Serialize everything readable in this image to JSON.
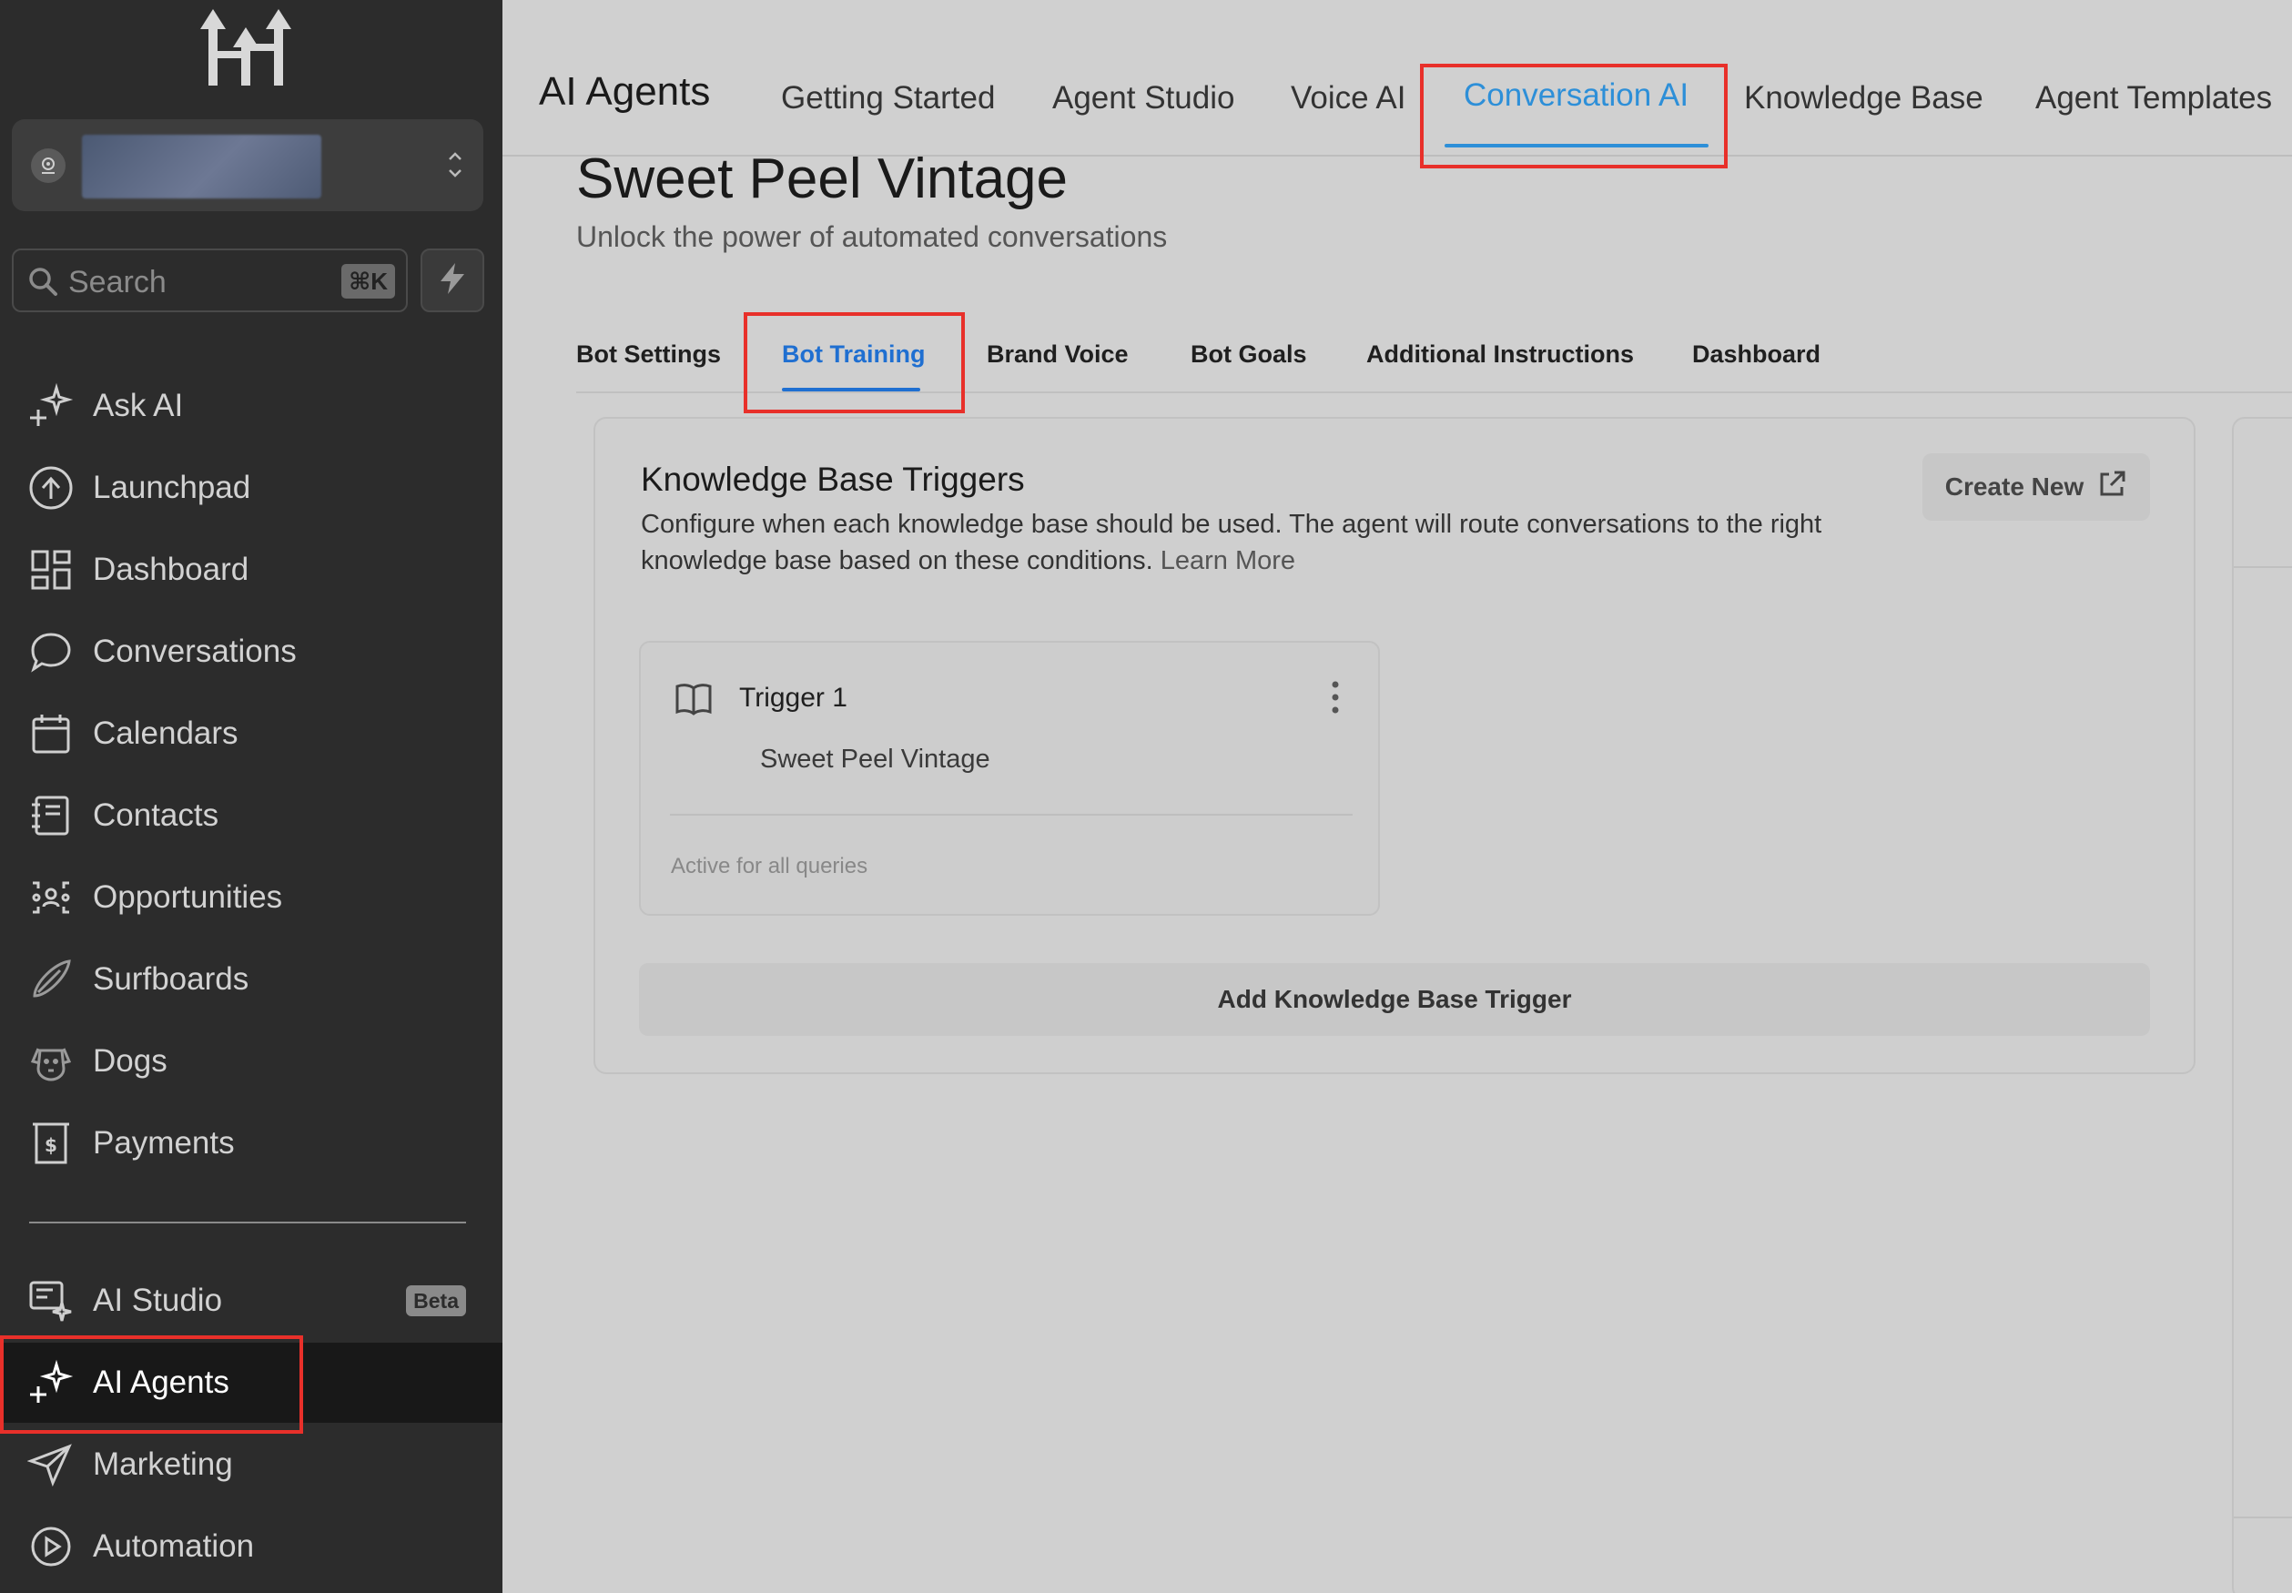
{
  "sidebar": {
    "search": {
      "placeholder": "Search",
      "shortcut": "⌘K"
    },
    "items": [
      {
        "label": "Ask AI",
        "icon": "sparkle-plus-icon"
      },
      {
        "label": "Launchpad",
        "icon": "launchpad-icon"
      },
      {
        "label": "Dashboard",
        "icon": "dashboard-grid-icon"
      },
      {
        "label": "Conversations",
        "icon": "chat-bubble-icon"
      },
      {
        "label": "Calendars",
        "icon": "calendar-icon"
      },
      {
        "label": "Contacts",
        "icon": "contacts-book-icon"
      },
      {
        "label": "Opportunities",
        "icon": "opportunities-icon"
      },
      {
        "label": "Surfboards",
        "icon": "surfboard-icon"
      },
      {
        "label": "Dogs",
        "icon": "dog-icon"
      },
      {
        "label": "Payments",
        "icon": "payments-receipt-icon"
      }
    ],
    "bottom_items": [
      {
        "label": "AI Studio",
        "icon": "ai-studio-icon",
        "badge": "Beta"
      },
      {
        "label": "AI Agents",
        "icon": "sparkle-plus-icon",
        "active": true
      },
      {
        "label": "Marketing",
        "icon": "send-icon"
      },
      {
        "label": "Automation",
        "icon": "automation-play-icon"
      }
    ]
  },
  "topnav": {
    "title": "AI Agents",
    "tabs": [
      {
        "label": "Getting Started"
      },
      {
        "label": "Agent Studio"
      },
      {
        "label": "Voice AI"
      },
      {
        "label": "Conversation AI",
        "active": true
      },
      {
        "label": "Knowledge Base"
      },
      {
        "label": "Agent Templates"
      }
    ]
  },
  "page": {
    "title": "Sweet Peel Vintage",
    "subtitle": "Unlock the power of automated conversations"
  },
  "subtabs": [
    {
      "label": "Bot Settings"
    },
    {
      "label": "Bot Training",
      "active": true
    },
    {
      "label": "Brand Voice"
    },
    {
      "label": "Bot Goals"
    },
    {
      "label": "Additional Instructions"
    },
    {
      "label": "Dashboard"
    }
  ],
  "kb_triggers": {
    "title": "Knowledge Base Triggers",
    "description": "Configure when each knowledge base should be used. The agent will route conversations to the right knowledge base based on these conditions.",
    "learn_more": "Learn More",
    "create_new": "Create New",
    "triggers": [
      {
        "name": "Trigger 1",
        "knowledge_base": "Sweet Peel Vintage",
        "status": "Active for all queries"
      }
    ],
    "add_button": "Add Knowledge Base Trigger"
  },
  "colors": {
    "accent_blue": "#2d8fd8",
    "subtab_active": "#1f6fd1",
    "highlight_red": "#e8302a",
    "sidebar_bg": "#2c2c2c"
  }
}
